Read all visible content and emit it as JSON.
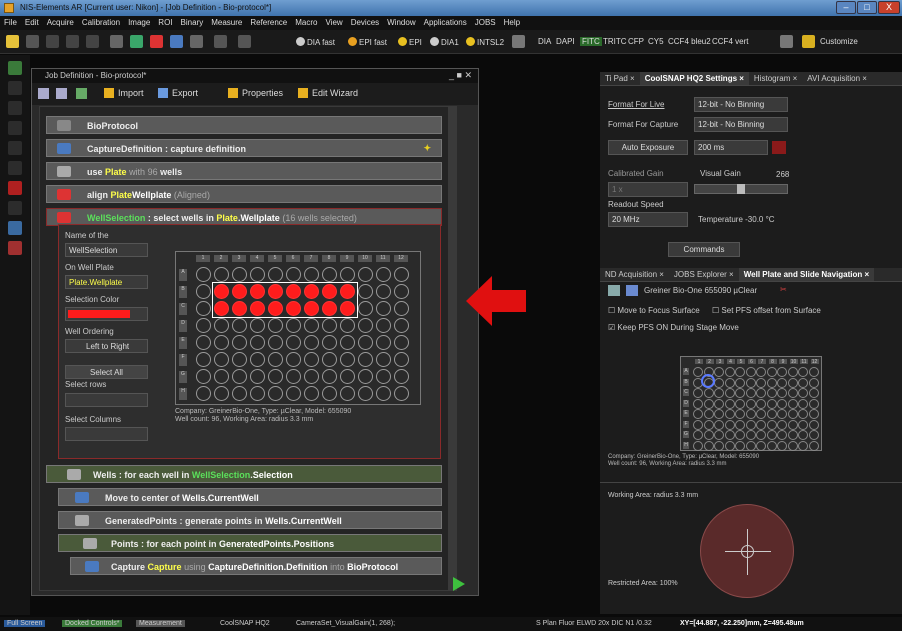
{
  "title": "NIS-Elements AR [Current user: Nikon] - [Job Definition - Bio-protocol*]",
  "window_controls": [
    "–",
    "□",
    "X"
  ],
  "menu": [
    "File",
    "Edit",
    "Acquire",
    "Calibration",
    "Image",
    "ROI",
    "Binary",
    "Measure",
    "Reference",
    "Macro",
    "View",
    "Devices",
    "Window",
    "Applications",
    "JOBS",
    "Help"
  ],
  "toolbar": {
    "presets": [
      "DIA fast",
      "EPI fast",
      "EPI",
      "DIA1",
      "INTSL2"
    ],
    "filters": [
      "DIA",
      "DAPI",
      "FITC",
      "TRITC",
      "CFP",
      "CY5",
      "CCF4 bleu2",
      "CCF4 vert"
    ],
    "customize": "Customize"
  },
  "job": {
    "title": "Job Definition - Bio-protocol*",
    "toolbar": {
      "import": "Import",
      "export": "Export",
      "properties": "Properties",
      "edit_wizard": "Edit Wizard"
    },
    "blocks": {
      "bioprotocol": "BioProtocol",
      "capturedef": "CaptureDefinition : capture definition",
      "plate_a": "use",
      "plate_b": "Plate",
      "plate_c": "with",
      "plate_d": "96",
      "plate_e": "wells",
      "align_a": "align",
      "align_b": "Plate",
      "align_c": "Wellplate",
      "align_d": "(Aligned)",
      "ws_a": "WellSelection",
      "ws_b": ": select wells in",
      "ws_c": "Plate",
      "ws_d": "Wellplate",
      "ws_e": "(16 wells selected)",
      "wells_a": "Wells",
      "wells_b": ": for each well in",
      "wells_c": "WellSelection",
      "wells_d": "Selection",
      "move_a": "Move to center of",
      "move_b": "Wells.CurrentWell",
      "gp_a": "GeneratedPoints",
      "gp_b": ": generate points in",
      "gp_c": "Wells.CurrentWell",
      "pts_a": "Points",
      "pts_b": ": for each point in",
      "pts_c": "GeneratedPoints.Positions",
      "cap_a": "Capture",
      "cap_b": "Capture",
      "cap_c": "using",
      "cap_d": "CaptureDefinition.Definition",
      "cap_e": "into",
      "cap_f": "BioProtocol"
    },
    "ws": {
      "name_label": "Name of the",
      "name_value": "WellSelection",
      "onwell_label": "On Well Plate",
      "onwell_value": "Plate.Wellplate",
      "color_label": "Selection Color",
      "ordering_label": "Well Ordering",
      "ordering_value": "Left to Right",
      "select_all": "Select All",
      "select_rows": "Select rows",
      "select_columns": "Select Columns",
      "company_line1": "Company: GreinerBio-One, Type: µClear, Model: 655090",
      "company_line2": "Well count: 96, Working Area: radius 3.3 mm"
    },
    "plate": {
      "rows": [
        "A",
        "B",
        "C",
        "D",
        "E",
        "F",
        "G",
        "H"
      ],
      "cols": [
        "1",
        "2",
        "3",
        "4",
        "5",
        "6",
        "7",
        "8",
        "9",
        "10",
        "11",
        "12"
      ],
      "selected": {
        "rows": [
          "B",
          "C"
        ],
        "cols_from": 2,
        "cols_to": 9
      }
    }
  },
  "right": {
    "tabs1": [
      "Ti Pad ×",
      "CoolSNAP HQ2 Settings ×",
      "Histogram ×",
      "AVI Acquisition ×"
    ],
    "format_live_label": "Format For Live",
    "format_live_value": "12-bit - No Binning",
    "format_capture_label": "Format For Capture",
    "format_capture_value": "12-bit - No Binning",
    "auto_exposure": "Auto Exposure",
    "exposure": "200 ms",
    "calibrated_gain": "Calibrated Gain",
    "visual_gain": "Visual Gain",
    "gain_value": "268",
    "gain_unit": "1 x",
    "readout_label": "Readout Speed",
    "readout_value": "20 MHz",
    "temperature": "Temperature -30.0 °C",
    "commands": "Commands",
    "tabs2": [
      "ND Acquisition ×",
      "JOBS Explorer ×",
      "Well Plate and Slide Navigation ×"
    ],
    "plate_model": "Greiner Bio-One 655090 µClear",
    "move_focus": "Move to Focus Surface",
    "set_pfs": "Set PFS offset from Surface",
    "keep_pfs": "Keep PFS ON During Stage Move",
    "mini_company1": "Company: GreinerBio-One, Type: µClear, Model: 655090",
    "mini_company2": "Well count: 96, Working Area: radius 3.3 mm",
    "working_area": "Working Area: radius 3.3 mm",
    "restricted_area": "Restricted Area: 100%"
  },
  "status": {
    "tabs": [
      "Full Screen",
      "Docked Controls*",
      "Measurement"
    ],
    "camera": "CoolSNAP HQ2",
    "cameraset": "CameraSet_VisualGain(1, 268);",
    "objective": "S Plan Fluor ELWD 20x DIC N1 /0.32",
    "xyz": "XY=[44.887, -22.250]mm, Z=495.48um"
  },
  "colors": {
    "selection": "#ff1c1c",
    "arrow": "#e01010",
    "accent_green": "#5be05b",
    "accent_yellow": "#ffff4a"
  }
}
